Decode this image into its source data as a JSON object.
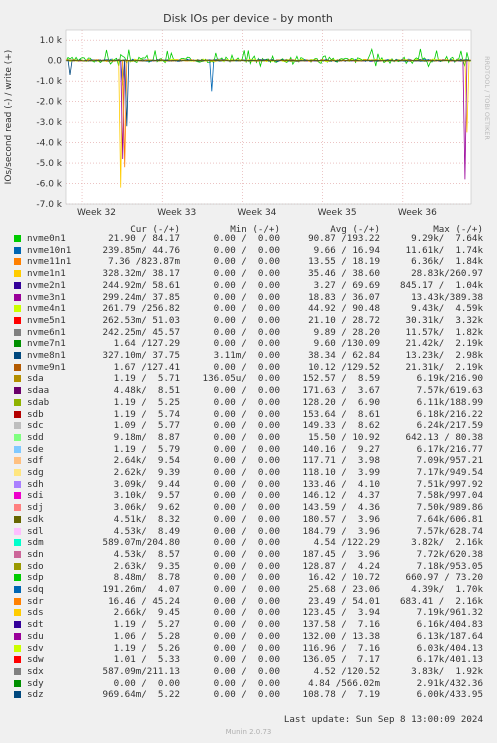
{
  "chart_data": {
    "type": "line",
    "title": "Disk IOs per device - by month",
    "ylabel": "IOs/second read (-) / write (+)",
    "side_label": "RRDTOOL / TOBI OETIKER",
    "ylim": [
      -7000,
      1500
    ],
    "yticks": [
      "1.0 k",
      "0.0",
      "-1.0 k",
      "-2.0 k",
      "-3.0 k",
      "-4.0 k",
      "-5.0 k",
      "-6.0 k",
      "-7.0 k"
    ],
    "ytick_values": [
      1000,
      0,
      -1000,
      -2000,
      -3000,
      -4000,
      -5000,
      -6000,
      -7000
    ],
    "xticks": [
      "Week 32",
      "Week 33",
      "Week 34",
      "Week 35",
      "Week 36"
    ],
    "grid": true,
    "series": [
      {
        "name": "nvme0n1",
        "color": "#00cc00",
        "cur": "21.90 / 84.17",
        "min": "0.00 /  0.00",
        "avg": "90.87 /193.22",
        "max": "9.29k/  7.64k"
      },
      {
        "name": "nvme10n1",
        "color": "#0066b3",
        "cur": "239.85m/ 44.76",
        "min": "0.00 /  0.00",
        "avg": "9.66 / 16.94",
        "max": "11.61k/  1.74k"
      },
      {
        "name": "nvme11n1",
        "color": "#ff8000",
        "cur": "7.36 /823.87m",
        "min": "0.00 /  0.00",
        "avg": "13.55 / 18.19",
        "max": "6.36k/  1.84k"
      },
      {
        "name": "nvme1n1",
        "color": "#ffcc00",
        "cur": "328.32m/ 38.17",
        "min": "0.00 /  0.00",
        "avg": "35.46 / 38.60",
        "max": "28.83k/260.97"
      },
      {
        "name": "nvme2n1",
        "color": "#330099",
        "cur": "244.92m/ 58.61",
        "min": "0.00 /  0.00",
        "avg": "3.27 / 69.69",
        "max": "845.17 /  1.04k"
      },
      {
        "name": "nvme3n1",
        "color": "#990099",
        "cur": "299.24m/ 37.85",
        "min": "0.00 /  0.00",
        "avg": "18.83 / 36.07",
        "max": "13.43k/389.38"
      },
      {
        "name": "nvme4n1",
        "color": "#ccff00",
        "cur": "261.79 /256.82",
        "min": "0.00 /  0.00",
        "avg": "44.92 / 90.48",
        "max": "9.43k/  4.59k"
      },
      {
        "name": "nvme5n1",
        "color": "#ff0000",
        "cur": "262.53m/ 51.03",
        "min": "0.00 /  0.00",
        "avg": "21.10 / 28.72",
        "max": "30.31k/  3.32k"
      },
      {
        "name": "nvme6n1",
        "color": "#808080",
        "cur": "242.25m/ 45.57",
        "min": "0.00 /  0.00",
        "avg": "9.89 / 28.20",
        "max": "11.57k/  1.82k"
      },
      {
        "name": "nvme7n1",
        "color": "#008f00",
        "cur": "1.64 /127.29",
        "min": "0.00 /  0.00",
        "avg": "9.60 /130.09",
        "max": "21.42k/  2.19k"
      },
      {
        "name": "nvme8n1",
        "color": "#00487d",
        "cur": "327.10m/ 37.75",
        "min": "3.11m/  0.00",
        "avg": "38.34 / 62.84",
        "max": "13.23k/  2.98k"
      },
      {
        "name": "nvme9n1",
        "color": "#b35a00",
        "cur": "1.67 /127.41",
        "min": "0.00 /  0.00",
        "avg": "10.12 /129.52",
        "max": "21.31k/  2.19k"
      },
      {
        "name": "sda",
        "color": "#b38f00",
        "cur": "1.19 /  5.71",
        "min": "136.05u/  0.00",
        "avg": "152.57 /  8.59",
        "max": "6.19k/216.90"
      },
      {
        "name": "sdaa",
        "color": "#6b006b",
        "cur": "4.48k/  8.51",
        "min": "0.00 /  0.00",
        "avg": "171.63 /  3.67",
        "max": "7.57k/619.63"
      },
      {
        "name": "sdab",
        "color": "#8fb300",
        "cur": "1.19 /  5.25",
        "min": "0.00 /  0.00",
        "avg": "128.20 /  6.90",
        "max": "6.11k/188.99"
      },
      {
        "name": "sdb",
        "color": "#b30000",
        "cur": "1.19 /  5.74",
        "min": "0.00 /  0.00",
        "avg": "153.64 /  8.61",
        "max": "6.18k/216.22"
      },
      {
        "name": "sdc",
        "color": "#bebebe",
        "cur": "1.09 /  5.77",
        "min": "0.00 /  0.00",
        "avg": "149.33 /  8.62",
        "max": "6.24k/217.59"
      },
      {
        "name": "sdd",
        "color": "#80ff80",
        "cur": "9.18m/  8.87",
        "min": "0.00 /  0.00",
        "avg": "15.50 / 10.92",
        "max": "642.13 / 80.38"
      },
      {
        "name": "sde",
        "color": "#80c9ff",
        "cur": "1.19 /  5.79",
        "min": "0.00 /  0.00",
        "avg": "140.16 /  9.27",
        "max": "6.17k/216.77"
      },
      {
        "name": "sdf",
        "color": "#ffc080",
        "cur": "2.64k/  9.54",
        "min": "0.00 /  0.00",
        "avg": "117.71 /  3.98",
        "max": "7.09k/957.21"
      },
      {
        "name": "sdg",
        "color": "#ffe680",
        "cur": "2.62k/  9.39",
        "min": "0.00 /  0.00",
        "avg": "118.10 /  3.99",
        "max": "7.17k/949.54"
      },
      {
        "name": "sdh",
        "color": "#aa80ff",
        "cur": "3.09k/  9.44",
        "min": "0.00 /  0.00",
        "avg": "133.46 /  4.10",
        "max": "7.51k/997.92"
      },
      {
        "name": "sdi",
        "color": "#ee00cc",
        "cur": "3.10k/  9.57",
        "min": "0.00 /  0.00",
        "avg": "146.12 /  4.37",
        "max": "7.58k/997.04"
      },
      {
        "name": "sdj",
        "color": "#ff8080",
        "cur": "3.06k/  9.62",
        "min": "0.00 /  0.00",
        "avg": "143.59 /  4.36",
        "max": "7.50k/989.86"
      },
      {
        "name": "sdk",
        "color": "#666600",
        "cur": "4.51k/  8.32",
        "min": "0.00 /  0.00",
        "avg": "180.57 /  3.96",
        "max": "7.64k/606.81"
      },
      {
        "name": "sdl",
        "color": "#ffbfff",
        "cur": "4.53k/  8.49",
        "min": "0.00 /  0.00",
        "avg": "184.79 /  3.96",
        "max": "7.57k/628.74"
      },
      {
        "name": "sdm",
        "color": "#00ffcc",
        "cur": "589.07m/204.80",
        "min": "0.00 /  0.00",
        "avg": "4.54 /122.29",
        "max": "3.82k/  2.16k"
      },
      {
        "name": "sdn",
        "color": "#cc6699",
        "cur": "4.53k/  8.57",
        "min": "0.00 /  0.00",
        "avg": "187.45 /  3.96",
        "max": "7.72k/620.38"
      },
      {
        "name": "sdo",
        "color": "#999900",
        "cur": "2.63k/  9.35",
        "min": "0.00 /  0.00",
        "avg": "128.87 /  4.24",
        "max": "7.18k/953.05"
      },
      {
        "name": "sdp",
        "color": "#00cc00",
        "cur": "8.48m/  8.78",
        "min": "0.00 /  0.00",
        "avg": "16.42 / 10.72",
        "max": "660.97 / 73.20"
      },
      {
        "name": "sdq",
        "color": "#0066b3",
        "cur": "191.26m/  4.07",
        "min": "0.00 /  0.00",
        "avg": "25.68 / 23.06",
        "max": "4.39k/  1.70k"
      },
      {
        "name": "sdr",
        "color": "#ff8000",
        "cur": "16.46 / 45.24",
        "min": "0.00 /  0.00",
        "avg": "23.49 / 54.01",
        "max": "683.41 /  2.16k"
      },
      {
        "name": "sds",
        "color": "#ffcc00",
        "cur": "2.66k/  9.45",
        "min": "0.00 /  0.00",
        "avg": "123.45 /  3.94",
        "max": "7.19k/961.32"
      },
      {
        "name": "sdt",
        "color": "#330099",
        "cur": "1.19 /  5.27",
        "min": "0.00 /  0.00",
        "avg": "137.58 /  7.16",
        "max": "6.16k/404.83"
      },
      {
        "name": "sdu",
        "color": "#990099",
        "cur": "1.06 /  5.28",
        "min": "0.00 /  0.00",
        "avg": "132.00 / 13.38",
        "max": "6.13k/187.64"
      },
      {
        "name": "sdv",
        "color": "#ccff00",
        "cur": "1.19 /  5.26",
        "min": "0.00 /  0.00",
        "avg": "116.96 /  7.16",
        "max": "6.03k/404.13"
      },
      {
        "name": "sdw",
        "color": "#ff0000",
        "cur": "1.01 /  5.33",
        "min": "0.00 /  0.00",
        "avg": "136.05 /  7.17",
        "max": "6.17k/401.13"
      },
      {
        "name": "sdx",
        "color": "#808080",
        "cur": "587.09m/211.13",
        "min": "0.00 /  0.00",
        "avg": "4.52 /120.52",
        "max": "3.83k/  1.92k"
      },
      {
        "name": "sdy",
        "color": "#008f00",
        "cur": "0.00 /  0.00",
        "min": "0.00 /  0.00",
        "avg": "4.84 /566.02m",
        "max": "2.91k/432.36"
      },
      {
        "name": "sdz",
        "color": "#00487d",
        "cur": "969.64m/  5.22",
        "min": "0.00 /  0.00",
        "avg": "108.78 /  7.19",
        "max": "6.00k/433.95"
      }
    ],
    "col_headers": {
      "cur": "Cur (-/+)",
      "min": "Min (-/+)",
      "avg": "Avg (-/+)",
      "max": "Max (-/+)"
    },
    "last_update": "Last update: Sun Sep  8 13:00:09 2024",
    "footer": "Munin 2.0.73"
  }
}
